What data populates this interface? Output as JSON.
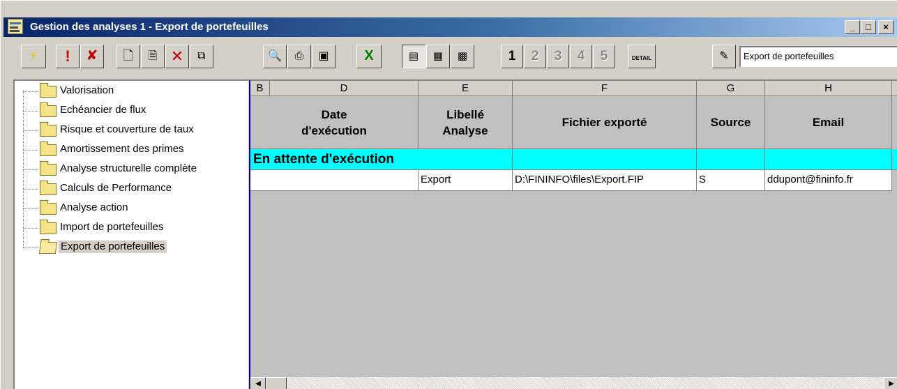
{
  "window": {
    "title": "Gestion des analyses 1  -  Export de portefeuilles",
    "app_icon": "app-icon",
    "buttons": {
      "minimize": "_",
      "maximize": "□",
      "close": "×"
    }
  },
  "toolbar": {
    "icons": [
      "lightning-icon",
      "exclamation-icon",
      "cancel-run-icon",
      "new-document-icon",
      "properties-icon",
      "delete-icon",
      "window-icon",
      "print-preview-icon",
      "print-icon",
      "save-icon",
      "excel-icon",
      "view-tree-icon",
      "view-form-icon",
      "view-grid-icon"
    ],
    "numbers": [
      "1",
      "2",
      "3",
      "4",
      "5"
    ],
    "detail_label": "DETAIL",
    "edit_icon": "pencil-icon",
    "analysis_name": "Export de portefeuilles"
  },
  "tree": {
    "items": [
      {
        "label": "Valorisation"
      },
      {
        "label": "Echéancier de flux"
      },
      {
        "label": "Risque et couverture de taux"
      },
      {
        "label": "Amortissement des primes"
      },
      {
        "label": "Analyse structurelle complète"
      },
      {
        "label": "Calculs de Performance"
      },
      {
        "label": "Analyse action"
      },
      {
        "label": "Import de portefeuilles"
      },
      {
        "label": "Export de portefeuilles"
      }
    ],
    "selected_index": 8
  },
  "grid": {
    "column_letters": [
      "B",
      "D",
      "E",
      "F",
      "G",
      "H"
    ],
    "headers": {
      "date_line1": "Date",
      "date_line2": "d'exécution",
      "libelle_line1": "Libellé",
      "libelle_line2": "Analyse",
      "fichier": "Fichier exporté",
      "source": "Source",
      "email": "Email"
    },
    "section_label": "En attente d'exécution",
    "section_color": "#00ffff",
    "rows": [
      {
        "date": "",
        "libelle": "Export",
        "fichier": "D:\\FININFO\\files\\Export.FIP",
        "source": "S",
        "email": "ddupont@fininfo.fr"
      }
    ],
    "scroll_left": "◀",
    "scroll_right": "▶"
  }
}
